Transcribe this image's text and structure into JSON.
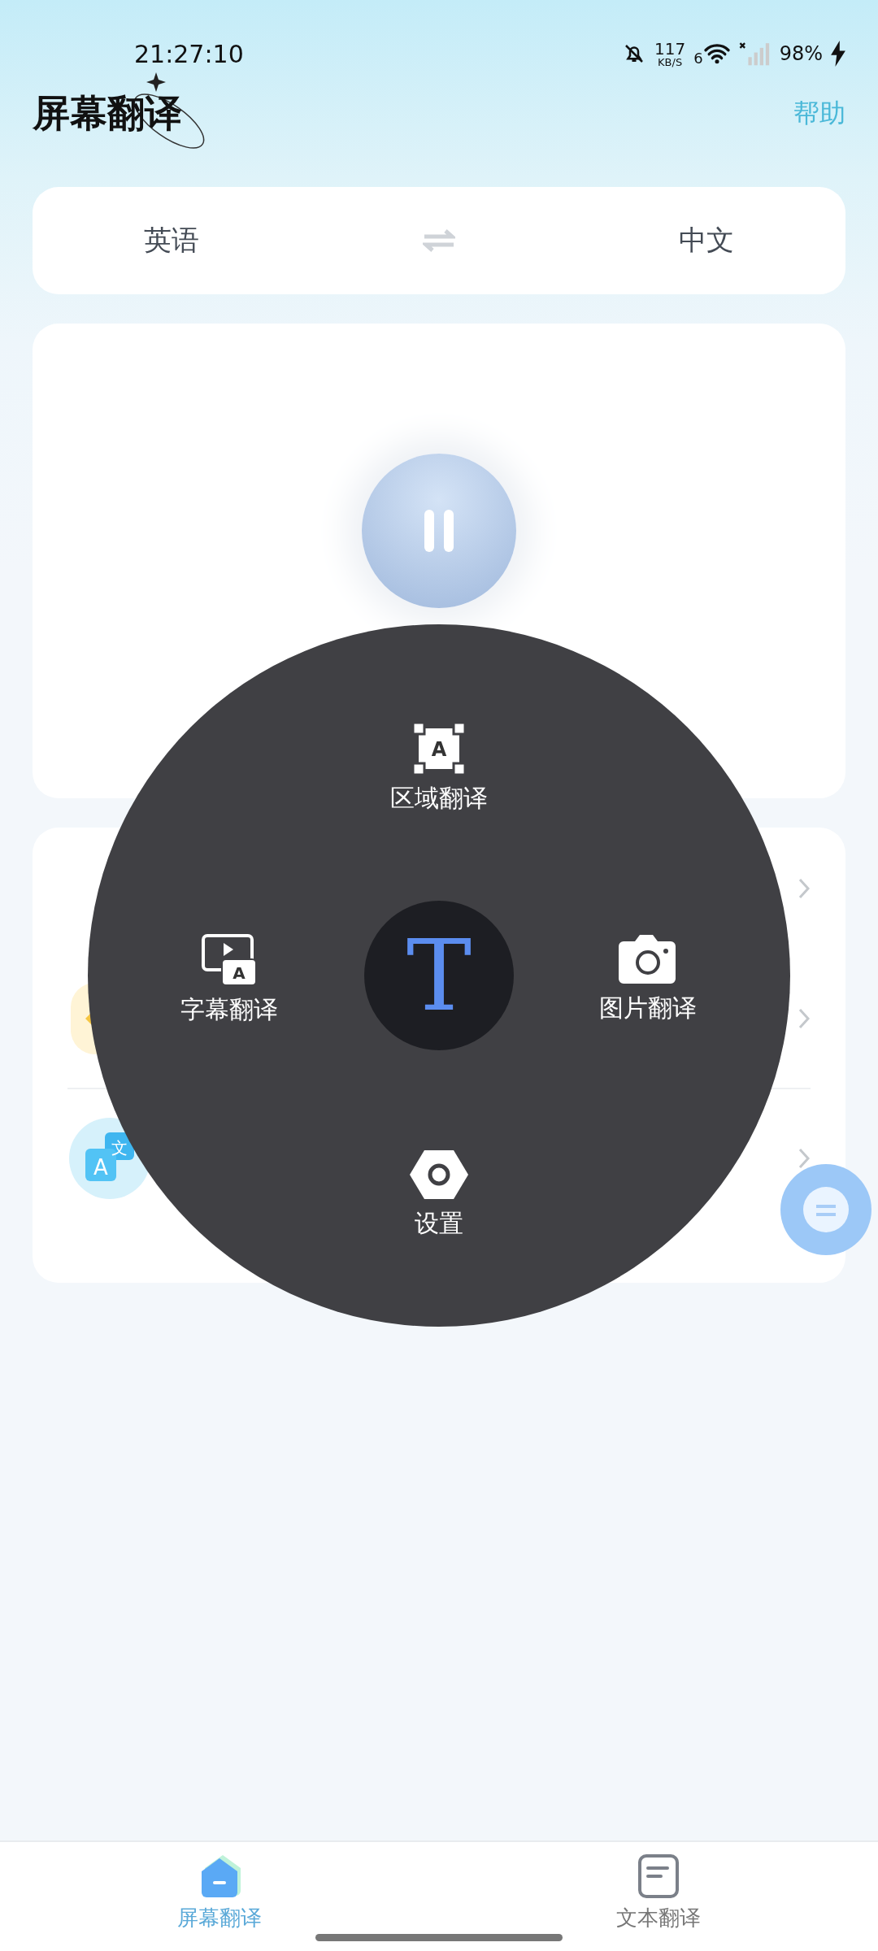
{
  "status_bar": {
    "time": "21:27:10",
    "net_speed": "117",
    "net_unit": "KB/S",
    "wifi_label": "6",
    "battery": "98%"
  },
  "header": {
    "title": "屏幕翻译",
    "help": "帮助"
  },
  "language_bar": {
    "source": "英语",
    "target": "中文"
  },
  "settings": {
    "rows": [
      {
        "kind": "ocr"
      },
      {
        "kind": "translate",
        "icon_glyphs": [
          "A",
          "文"
        ]
      }
    ]
  },
  "radial_menu": {
    "center_glyph": "T",
    "items": [
      {
        "kind": "region",
        "label": "区域翻译",
        "icon_glyph": "A"
      },
      {
        "kind": "subtitle",
        "label": "字幕翻译",
        "icon_glyph": "A"
      },
      {
        "kind": "photo",
        "label": "图片翻译"
      },
      {
        "kind": "settings",
        "label": "设置"
      }
    ]
  },
  "bottom_nav": [
    {
      "kind": "screen",
      "label": "屏幕翻译",
      "selected": true
    },
    {
      "kind": "text",
      "label": "文本翻译",
      "selected": false
    }
  ]
}
